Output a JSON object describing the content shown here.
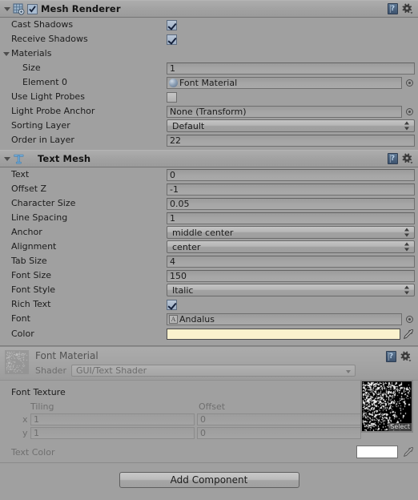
{
  "mesh_renderer": {
    "title": "Mesh Renderer",
    "icon": "mesh-renderer-icon",
    "enabled": true,
    "help_icon": "help-book-icon",
    "gear_icon": "gear-icon",
    "rows": {
      "cast_shadows": {
        "label": "Cast Shadows",
        "value": "checked"
      },
      "receive_shadows": {
        "label": "Receive Shadows",
        "value": "checked"
      },
      "materials": {
        "label": "Materials"
      },
      "size": {
        "label": "Size",
        "value": "1"
      },
      "element0": {
        "label": "Element 0",
        "value": "Font Material",
        "icon": "material-sphere-icon"
      },
      "use_light_probes": {
        "label": "Use Light Probes",
        "value": "unchecked"
      },
      "light_probe_anchor": {
        "label": "Light Probe Anchor",
        "value": "None (Transform)"
      },
      "sorting_layer": {
        "label": "Sorting Layer",
        "value": "Default"
      },
      "order_in_layer": {
        "label": "Order in Layer",
        "value": "22"
      }
    }
  },
  "text_mesh": {
    "title": "Text Mesh",
    "icon": "text-mesh-icon",
    "rows": {
      "text": {
        "label": "Text",
        "value": "0"
      },
      "offset_z": {
        "label": "Offset Z",
        "value": "-1"
      },
      "character_size": {
        "label": "Character Size",
        "value": "0.05"
      },
      "line_spacing": {
        "label": "Line Spacing",
        "value": "1"
      },
      "anchor": {
        "label": "Anchor",
        "value": "middle center"
      },
      "alignment": {
        "label": "Alignment",
        "value": "center"
      },
      "tab_size": {
        "label": "Tab Size",
        "value": "4"
      },
      "font_size": {
        "label": "Font Size",
        "value": "150"
      },
      "font_style": {
        "label": "Font Style",
        "value": "Italic"
      },
      "rich_text": {
        "label": "Rich Text",
        "value": "checked"
      },
      "font": {
        "label": "Font",
        "value": "Andalus",
        "icon": "font-asset-icon"
      },
      "color": {
        "label": "Color",
        "value": "#FBF2CD",
        "eyedropper": "eyedropper-icon"
      }
    }
  },
  "material": {
    "title": "Font Material",
    "shader_label": "Shader",
    "shader_value": "GUI/Text Shader",
    "help_icon": "help-book-icon",
    "gear_icon": "gear-icon",
    "font_texture": {
      "label": "Font Texture",
      "tiling_header": "Tiling",
      "offset_header": "Offset",
      "x_letter": "x",
      "y_letter": "y",
      "tiling_x": "1",
      "tiling_y": "1",
      "offset_x": "0",
      "offset_y": "0",
      "preview_select": "Select"
    },
    "text_color": {
      "label": "Text Color",
      "value": "#FFFFFF",
      "eyedropper": "eyedropper-icon"
    }
  },
  "footer": {
    "add_component": "Add Component"
  },
  "colors": {
    "panel_bg": "#a0a0a0",
    "header_bg": "#a8a8a8",
    "field_bg": "#a4a4a4",
    "field_border": "#6f6f6f",
    "text": "#1b1b1b",
    "dim_text": "#6f6f6f",
    "accent_blue": "#5d7792",
    "color_swatch": "#FBF2CD",
    "text_color_swatch": "#FFFFFF"
  }
}
